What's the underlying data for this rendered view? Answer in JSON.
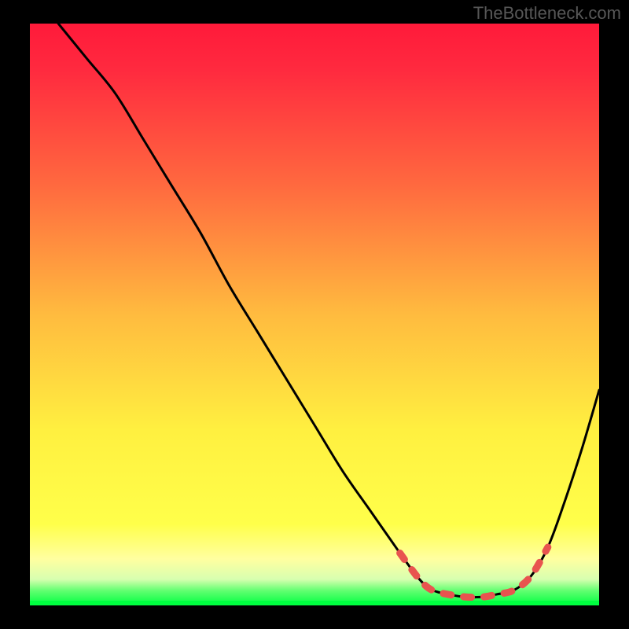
{
  "watermark": "TheBottleneck.com",
  "colors": {
    "black": "#000000",
    "red": "#ff1a3a",
    "orange": "#ff8a3a",
    "yellow": "#ffff4a",
    "paleYellow": "#ffffa0",
    "brightGreen": "#00ff40",
    "curve": "#000000",
    "curveBottom": "#e8544f"
  },
  "chart_data": {
    "type": "line",
    "title": "",
    "xlabel": "",
    "ylabel": "",
    "xlim": [
      0,
      100
    ],
    "ylim": [
      0,
      100
    ],
    "x": [
      5,
      10,
      15,
      20,
      25,
      30,
      35,
      40,
      45,
      50,
      55,
      60,
      65,
      68,
      70,
      72,
      74,
      76,
      78,
      80,
      82,
      85,
      88,
      91,
      94,
      97,
      100
    ],
    "y": [
      100,
      94,
      88,
      80,
      72,
      64,
      55,
      47,
      39,
      31,
      23,
      16,
      9,
      5,
      3,
      2.2,
      1.8,
      1.5,
      1.4,
      1.5,
      1.9,
      2.6,
      5,
      10,
      18,
      27,
      37
    ],
    "annotations": "Curve descends steeply from top-left toward bottom-right valley near x≈75 then rises again; valley region drawn in #e8544f"
  }
}
